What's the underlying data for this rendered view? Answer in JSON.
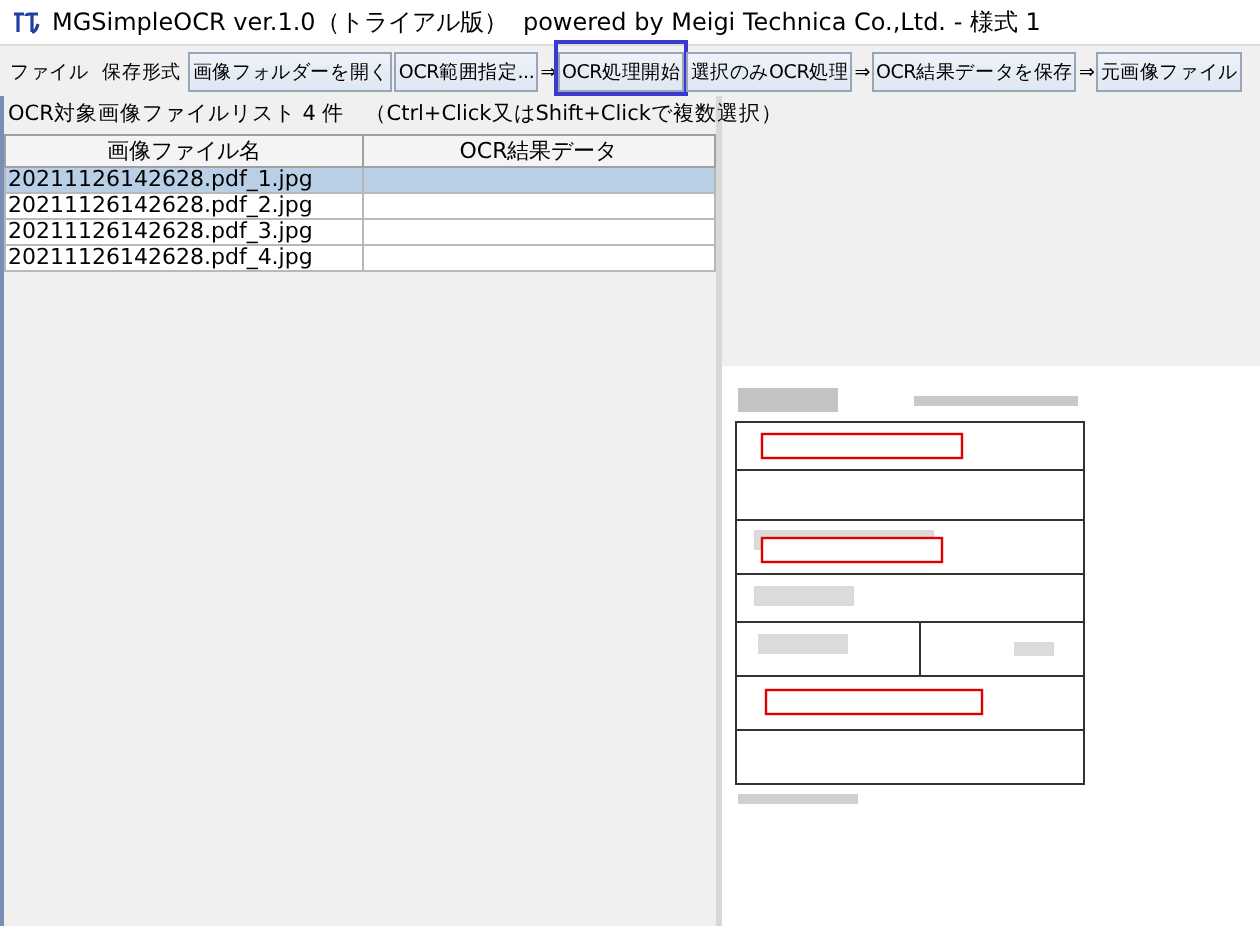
{
  "window": {
    "title": "MGSimpleOCR ver.1.0（トライアル版）  powered by Meigi Technica Co.,Ltd. - 様式 1"
  },
  "toolbar": [
    {
      "kind": "menu",
      "label": "ファイル"
    },
    {
      "kind": "menu",
      "label": "保存形式"
    },
    {
      "kind": "button",
      "label": "画像フォルダーを開く",
      "highlighted": false
    },
    {
      "kind": "button",
      "label": "OCR範囲指定...",
      "highlighted": false
    },
    {
      "kind": "arrow",
      "label": "⇒"
    },
    {
      "kind": "button",
      "label": "OCR処理開始",
      "highlighted": true
    },
    {
      "kind": "button",
      "label": "選択のみOCR処理",
      "highlighted": false
    },
    {
      "kind": "arrow",
      "label": "⇒"
    },
    {
      "kind": "button",
      "label": "OCR結果データを保存",
      "highlighted": false
    },
    {
      "kind": "arrow",
      "label": "⇒"
    },
    {
      "kind": "button",
      "label": "元画像ファイル",
      "highlighted": false
    }
  ],
  "file_list": {
    "label": "OCR対象画像ファイルリスト 4 件",
    "hint": "（Ctrl+Click又はShift+Clickで複数選択）",
    "columns": [
      "画像ファイル名",
      "OCR結果データ"
    ],
    "rows": [
      {
        "cells": [
          "20211126142628.pdf_1.jpg",
          ""
        ],
        "selected": true
      },
      {
        "cells": [
          "20211126142628.pdf_2.jpg",
          ""
        ],
        "selected": false
      },
      {
        "cells": [
          "20211126142628.pdf_3.jpg",
          ""
        ],
        "selected": false
      },
      {
        "cells": [
          "20211126142628.pdf_4.jpg",
          ""
        ],
        "selected": false
      }
    ]
  }
}
